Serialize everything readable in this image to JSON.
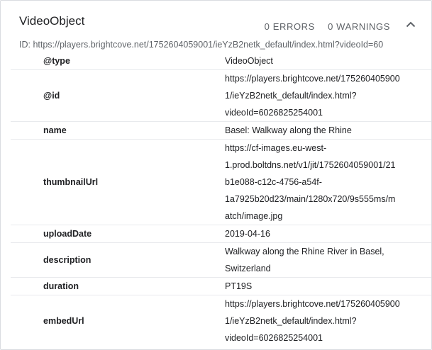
{
  "header": {
    "title": "VideoObject",
    "errors": "0 ERRORS",
    "warnings": "0 WARNINGS",
    "collapse_icon": "chevron-up-icon"
  },
  "id_line": "ID: https://players.brightcove.net/1752604059001/ieYzB2netk_default/index.html?videoId=60",
  "rows": [
    {
      "key": "@type",
      "lines": [
        "VideoObject"
      ]
    },
    {
      "key": "@id",
      "lines": [
        "https://players.brightcove.net/175260405900",
        "1/ieYzB2netk_default/index.html?",
        "videoId=6026825254001"
      ]
    },
    {
      "key": "name",
      "lines": [
        "Basel: Walkway along the Rhine"
      ]
    },
    {
      "key": "thumbnailUrl",
      "lines": [
        "https://cf-images.eu-west-",
        "1.prod.boltdns.net/v1/jit/1752604059001/21",
        "b1e088-c12c-4756-a54f-",
        "1a7925b20d23/main/1280x720/9s555ms/m",
        "atch/image.jpg"
      ]
    },
    {
      "key": "uploadDate",
      "lines": [
        "2019-04-16"
      ]
    },
    {
      "key": "description",
      "lines": [
        "Walkway along the Rhine River in Basel,",
        "Switzerland"
      ]
    },
    {
      "key": "duration",
      "lines": [
        "PT19S"
      ]
    },
    {
      "key": "embedUrl",
      "lines": [
        "https://players.brightcove.net/175260405900",
        "1/ieYzB2netk_default/index.html?",
        "videoId=6026825254001"
      ]
    }
  ]
}
